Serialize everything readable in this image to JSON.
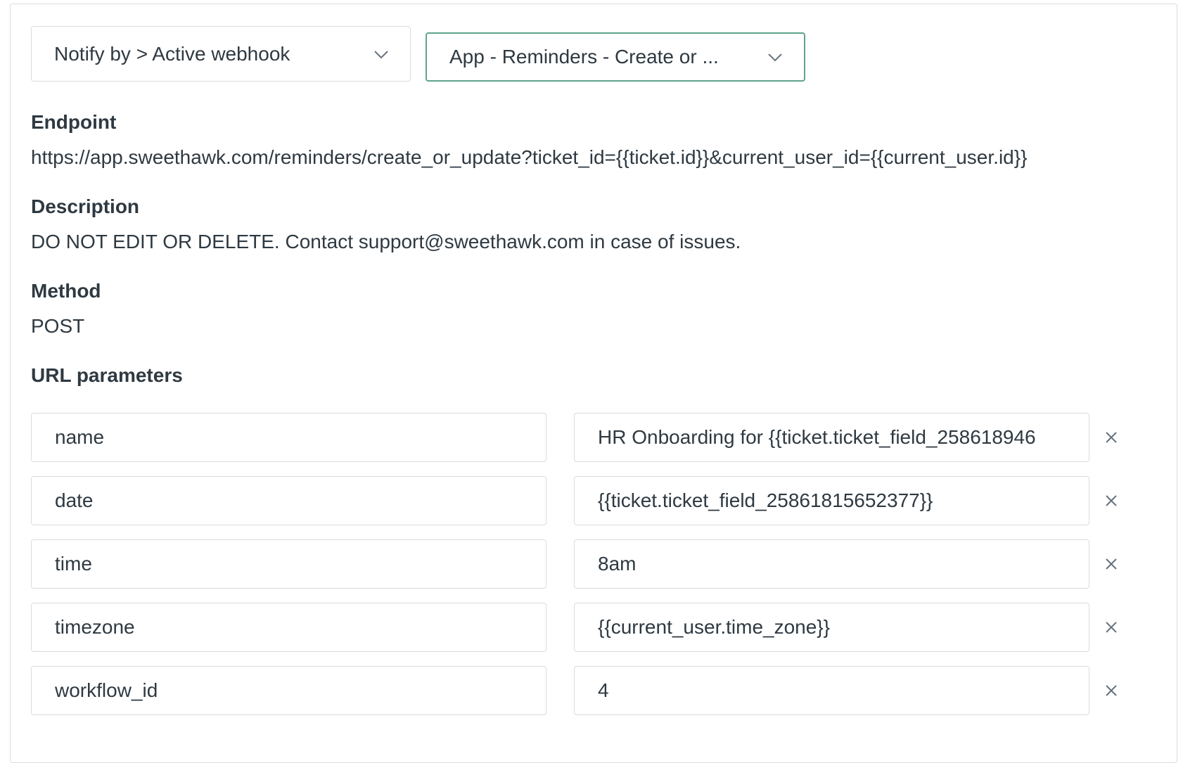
{
  "dropdowns": {
    "notify_by": "Notify by > Active webhook",
    "webhook": "App - Reminders - Create or ..."
  },
  "endpoint": {
    "label": "Endpoint",
    "value": "https://app.sweethawk.com/reminders/create_or_update?ticket_id={{ticket.id}}&current_user_id={{current_user.id}}"
  },
  "description": {
    "label": "Description",
    "value": "DO NOT EDIT OR DELETE. Contact support@sweethawk.com in case of issues."
  },
  "method": {
    "label": "Method",
    "value": "POST"
  },
  "url_parameters": {
    "label": "URL parameters",
    "rows": [
      {
        "key": "name",
        "value": "HR Onboarding for {{ticket.ticket_field_258618946"
      },
      {
        "key": "date",
        "value": "{{ticket.ticket_field_25861815652377}}"
      },
      {
        "key": "time",
        "value": "8am"
      },
      {
        "key": "timezone",
        "value": "{{current_user.time_zone}}"
      },
      {
        "key": "workflow_id",
        "value": "4"
      }
    ]
  },
  "icons": {
    "dropdown": "chevron-down-icon",
    "remove": "close-icon"
  },
  "colors": {
    "text": "#2f3941",
    "border": "#d8dcde",
    "selected_border": "#5fa48f",
    "icon": "#68737d"
  }
}
